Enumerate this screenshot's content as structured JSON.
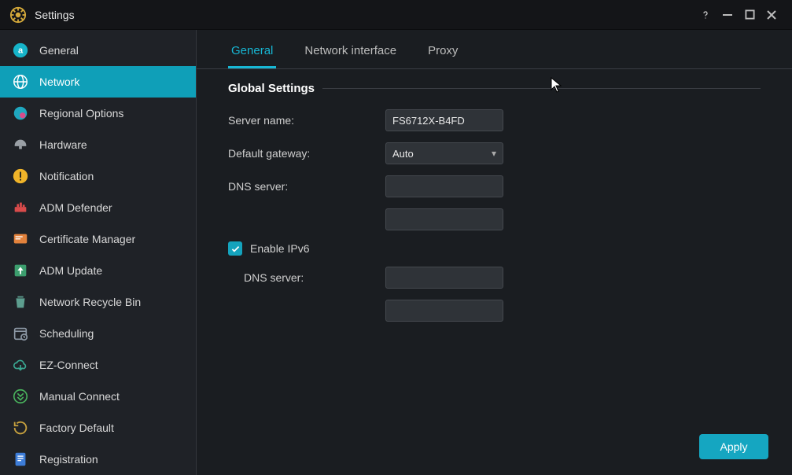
{
  "window": {
    "title": "Settings"
  },
  "sidebar": {
    "items": [
      {
        "label": "General"
      },
      {
        "label": "Network"
      },
      {
        "label": "Regional Options"
      },
      {
        "label": "Hardware"
      },
      {
        "label": "Notification"
      },
      {
        "label": "ADM Defender"
      },
      {
        "label": "Certificate Manager"
      },
      {
        "label": "ADM Update"
      },
      {
        "label": "Network Recycle Bin"
      },
      {
        "label": "Scheduling"
      },
      {
        "label": "EZ-Connect"
      },
      {
        "label": "Manual Connect"
      },
      {
        "label": "Factory Default"
      },
      {
        "label": "Registration"
      }
    ],
    "active_index": 1
  },
  "tabs": {
    "items": [
      {
        "label": "General"
      },
      {
        "label": "Network interface"
      },
      {
        "label": "Proxy"
      }
    ],
    "active_index": 0
  },
  "section": {
    "title": "Global Settings"
  },
  "form": {
    "server_name_label": "Server name:",
    "server_name_value": "FS6712X-B4FD",
    "default_gateway_label": "Default gateway:",
    "default_gateway_value": "Auto",
    "dns_server_label": "DNS server:",
    "dns1_value": "",
    "dns2_value": "",
    "enable_ipv6_label": "Enable IPv6",
    "enable_ipv6_checked": true,
    "ipv6_dns_label": "DNS server:",
    "ipv6_dns1_value": "",
    "ipv6_dns2_value": ""
  },
  "buttons": {
    "apply": "Apply"
  },
  "colors": {
    "accent": "#15a6c1",
    "sidebar_active": "#0f9fb8",
    "bg": "#1a1d21"
  }
}
